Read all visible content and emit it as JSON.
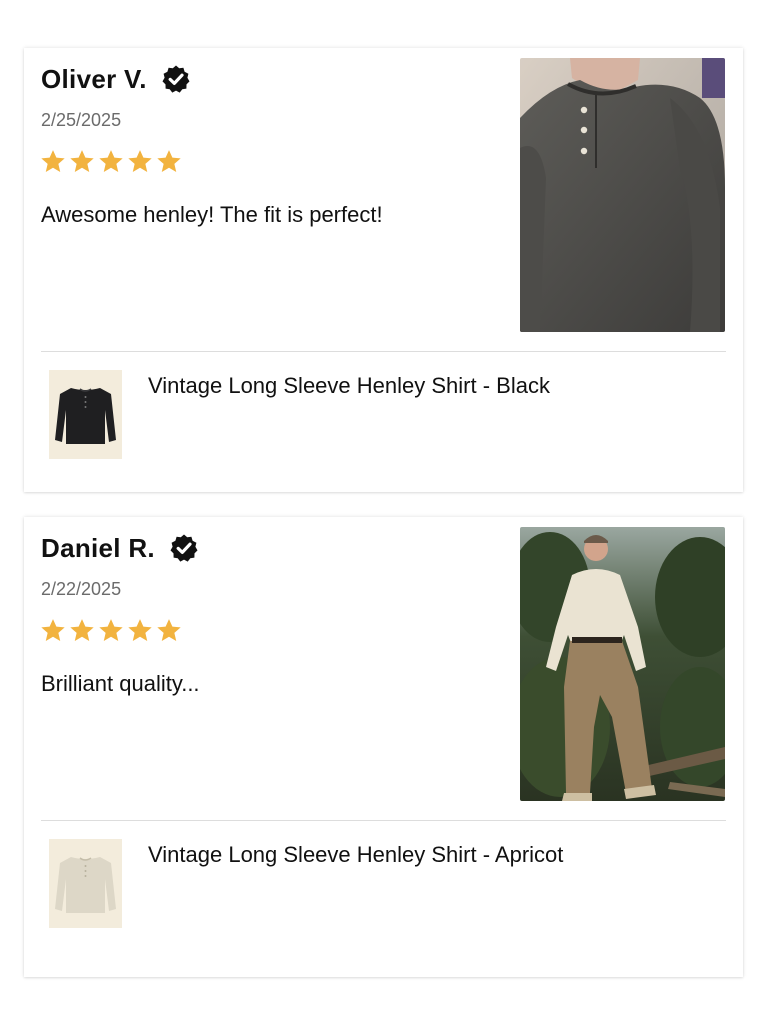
{
  "reviews": [
    {
      "reviewer": "Oliver V.",
      "verified_icon": "verified-check-icon",
      "date": "2/25/2025",
      "rating": 5,
      "text": "Awesome henley! The fit is perfect!",
      "product_name": "Vintage Long Sleeve Henley Shirt - Black"
    },
    {
      "reviewer": "Daniel R.",
      "verified_icon": "verified-check-icon",
      "date": "2/22/2025",
      "rating": 5,
      "text": "Brilliant quality...",
      "product_name": "Vintage Long Sleeve Henley Shirt - Apricot"
    }
  ],
  "colors": {
    "star": "#f2b33f",
    "verified_badge": "#111111",
    "date_text": "#6b6b6b",
    "divider": "#dddddd"
  }
}
